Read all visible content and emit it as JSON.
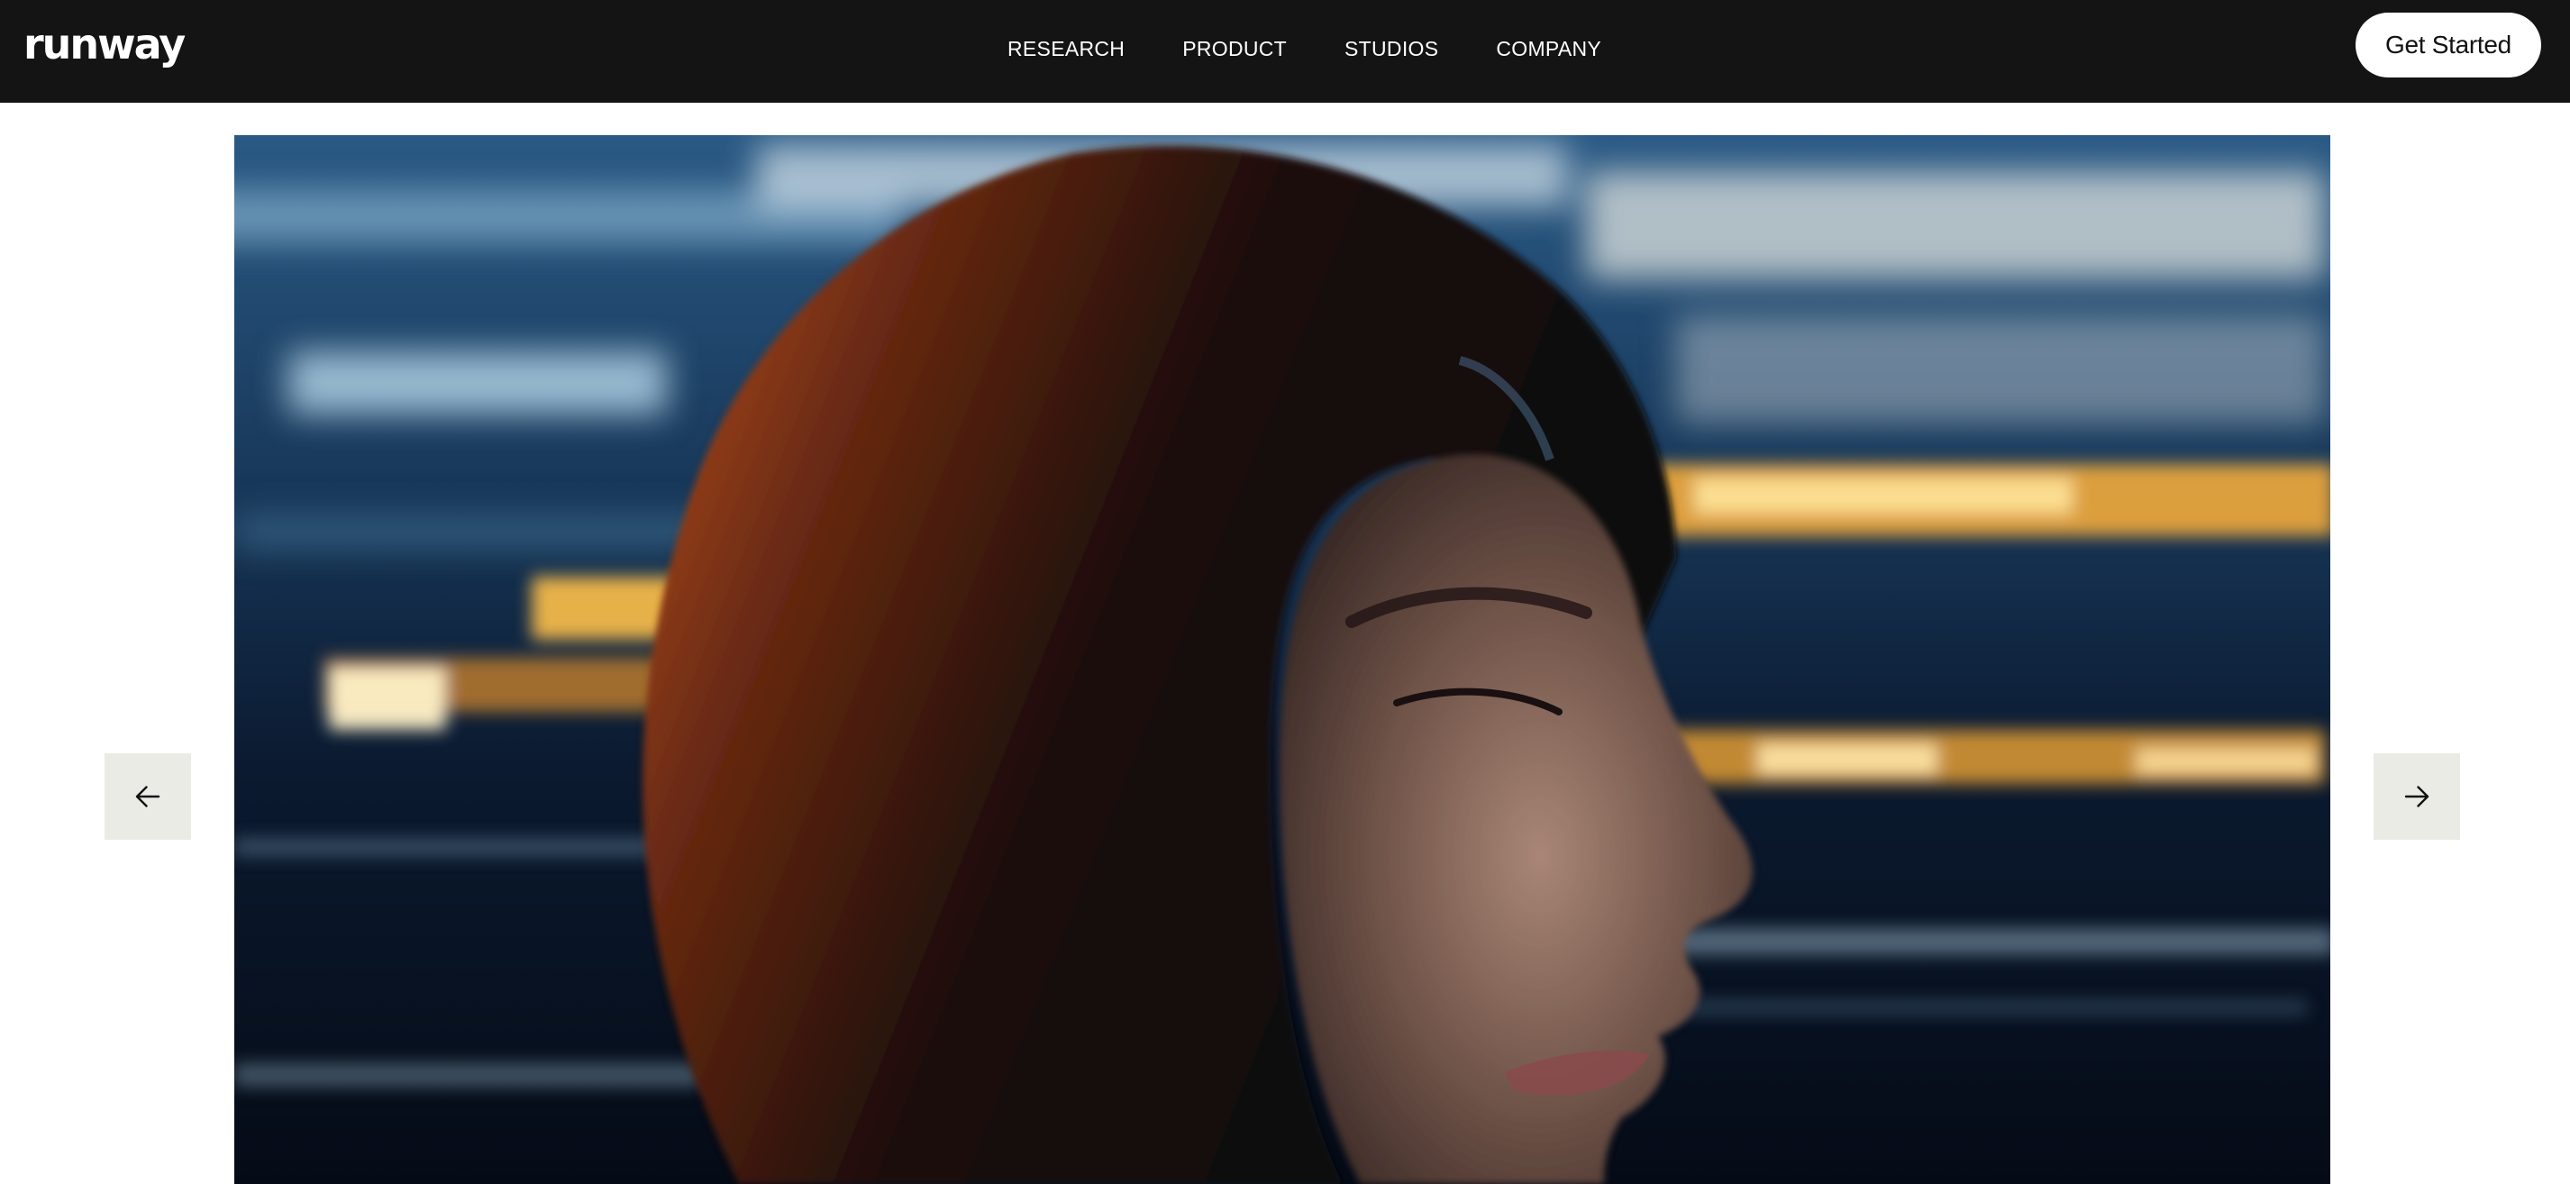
{
  "brand": {
    "logo": "runway"
  },
  "nav": {
    "links": [
      {
        "label": "RESEARCH"
      },
      {
        "label": "PRODUCT"
      },
      {
        "label": "STUDIOS"
      },
      {
        "label": "COMPANY"
      }
    ],
    "cta_label": "Get Started"
  },
  "carousel": {
    "prev_icon": "arrow-left-icon",
    "next_icon": "arrow-right-icon"
  },
  "colors": {
    "nav_background": "#141414",
    "page_background": "#ffffff",
    "arrow_background": "#ebebe6"
  }
}
